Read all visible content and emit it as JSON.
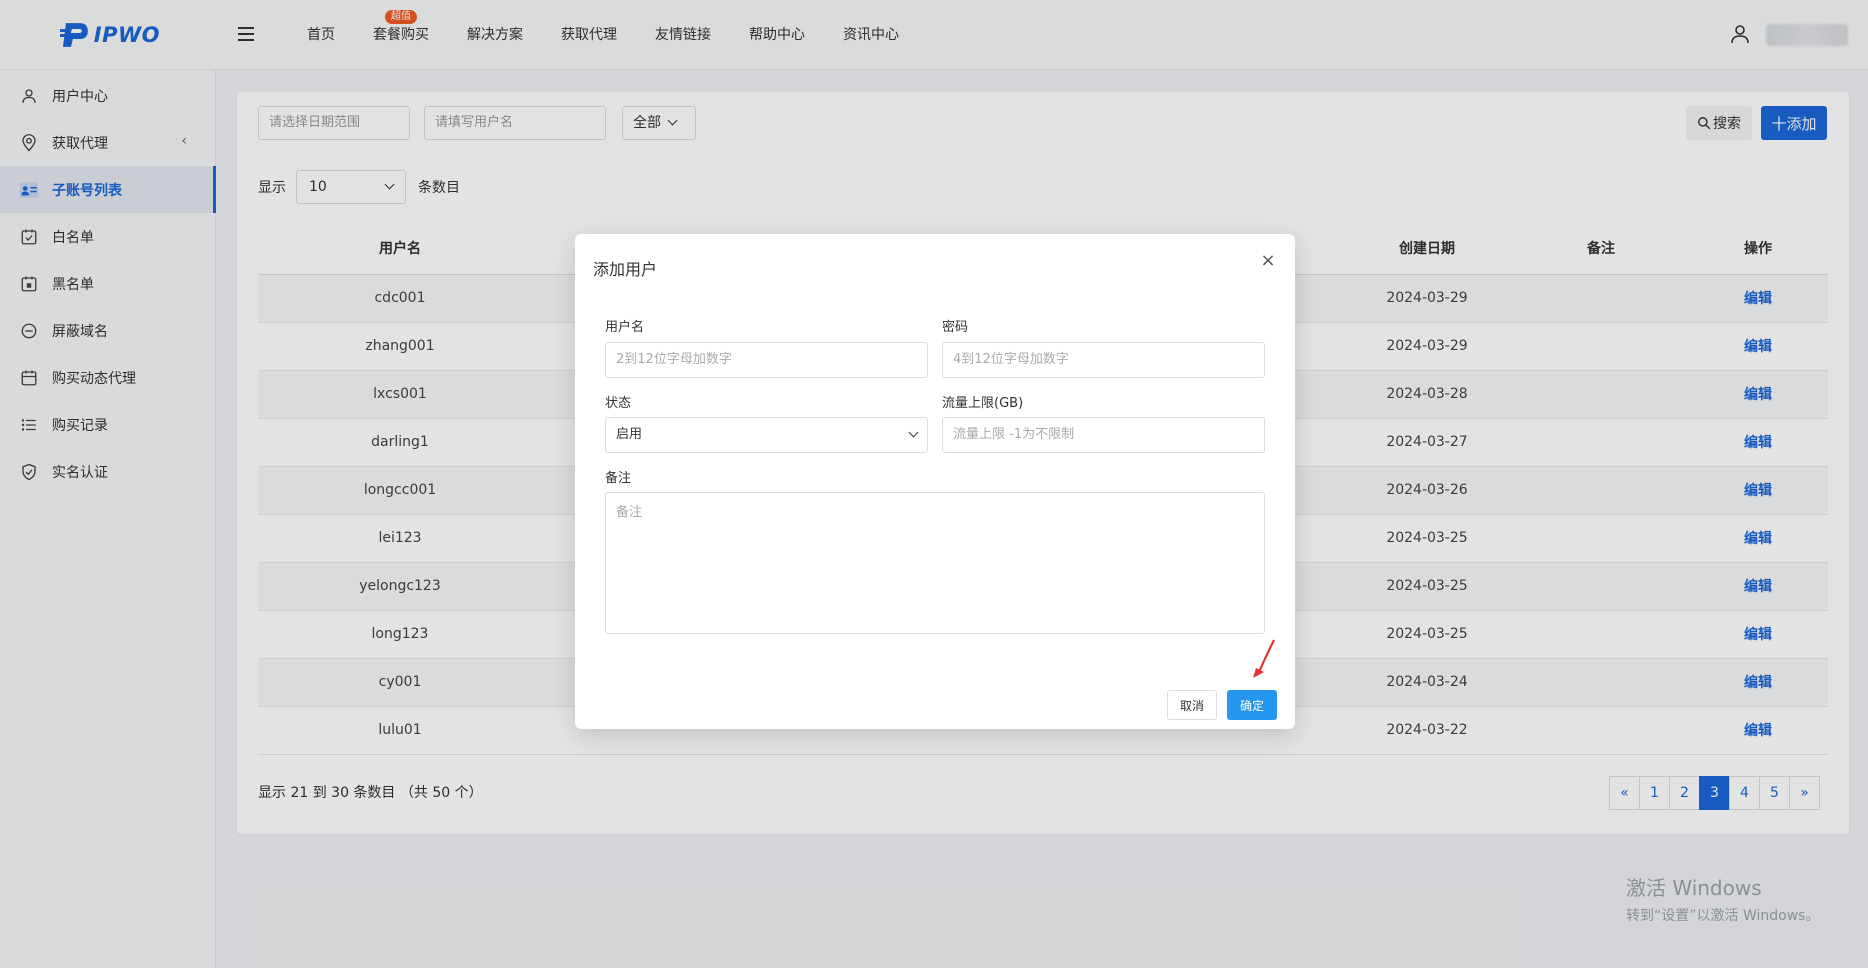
{
  "colors": {
    "brand": "#1a66d8",
    "hot_badge": "#f05a24",
    "confirm": "#2496f0",
    "annotation": "#e53333"
  },
  "logo": {
    "text": "IPWO"
  },
  "nav": {
    "items": [
      {
        "label": "首页"
      },
      {
        "label": "套餐购买",
        "badge": "超值"
      },
      {
        "label": "解决方案"
      },
      {
        "label": "获取代理"
      },
      {
        "label": "友情链接"
      },
      {
        "label": "帮助中心"
      },
      {
        "label": "资讯中心"
      }
    ]
  },
  "sidebar": {
    "items": [
      {
        "label": "用户中心",
        "icon": "user-icon"
      },
      {
        "label": "获取代理",
        "icon": "location-pin-icon"
      },
      {
        "label": "子账号列表",
        "icon": "contact-card-icon",
        "active": true
      },
      {
        "label": "白名单",
        "icon": "calendar-check-icon"
      },
      {
        "label": "黑名单",
        "icon": "calendar-x-icon"
      },
      {
        "label": "屏蔽域名",
        "icon": "minus-circle-icon"
      },
      {
        "label": "购买动态代理",
        "icon": "calendar-icon"
      },
      {
        "label": "购买记录",
        "icon": "list-icon"
      },
      {
        "label": "实名认证",
        "icon": "shield-check-icon"
      }
    ]
  },
  "filters": {
    "date_placeholder": "请选择日期范围",
    "username_placeholder": "请填写用户名",
    "status_value": "全部",
    "search_label": "搜索",
    "add_label": "十添加"
  },
  "page_size": {
    "prefix": "显示",
    "value": "10",
    "suffix": "条数目"
  },
  "table": {
    "headers": [
      "用户名",
      "",
      "",
      "",
      "创建日期",
      "备注",
      "操作"
    ],
    "rows": [
      {
        "username": "cdc001",
        "created": "2024-03-29",
        "action": "编辑"
      },
      {
        "username": "zhang001",
        "created": "2024-03-29",
        "action": "编辑"
      },
      {
        "username": "lxcs001",
        "created": "2024-03-28",
        "action": "编辑"
      },
      {
        "username": "darling1",
        "created": "2024-03-27",
        "action": "编辑"
      },
      {
        "username": "longcc001",
        "created": "2024-03-26",
        "action": "编辑"
      },
      {
        "username": "lei123",
        "created": "2024-03-25",
        "action": "编辑"
      },
      {
        "username": "yelongc123",
        "created": "2024-03-25",
        "action": "编辑"
      },
      {
        "username": "long123",
        "created": "2024-03-25",
        "action": "编辑"
      },
      {
        "username": "cy001",
        "created": "2024-03-24",
        "action": "编辑"
      },
      {
        "username": "lulu01",
        "created": "2024-03-22",
        "action": "编辑"
      }
    ]
  },
  "summary": "显示 21 到 30 条数目 （共 50 个）",
  "pagination": {
    "prev": "«",
    "pages": [
      "1",
      "2",
      "3",
      "4",
      "5"
    ],
    "current": "3",
    "next": "»"
  },
  "modal": {
    "title": "添加用户",
    "close": "×",
    "username_label": "用户名",
    "username_placeholder": "2到12位字母加数字",
    "password_label": "密码",
    "password_placeholder": "4到12位字母加数字",
    "status_label": "状态",
    "status_value": "启用",
    "quota_label": "流量上限(GB)",
    "quota_placeholder": "流量上限 -1为不限制",
    "remark_label": "备注",
    "remark_placeholder": "备注",
    "cancel_label": "取消",
    "ok_label": "确定"
  },
  "watermark": {
    "line1": "激活 Windows",
    "line2": "转到“设置”以激活 Windows。"
  }
}
